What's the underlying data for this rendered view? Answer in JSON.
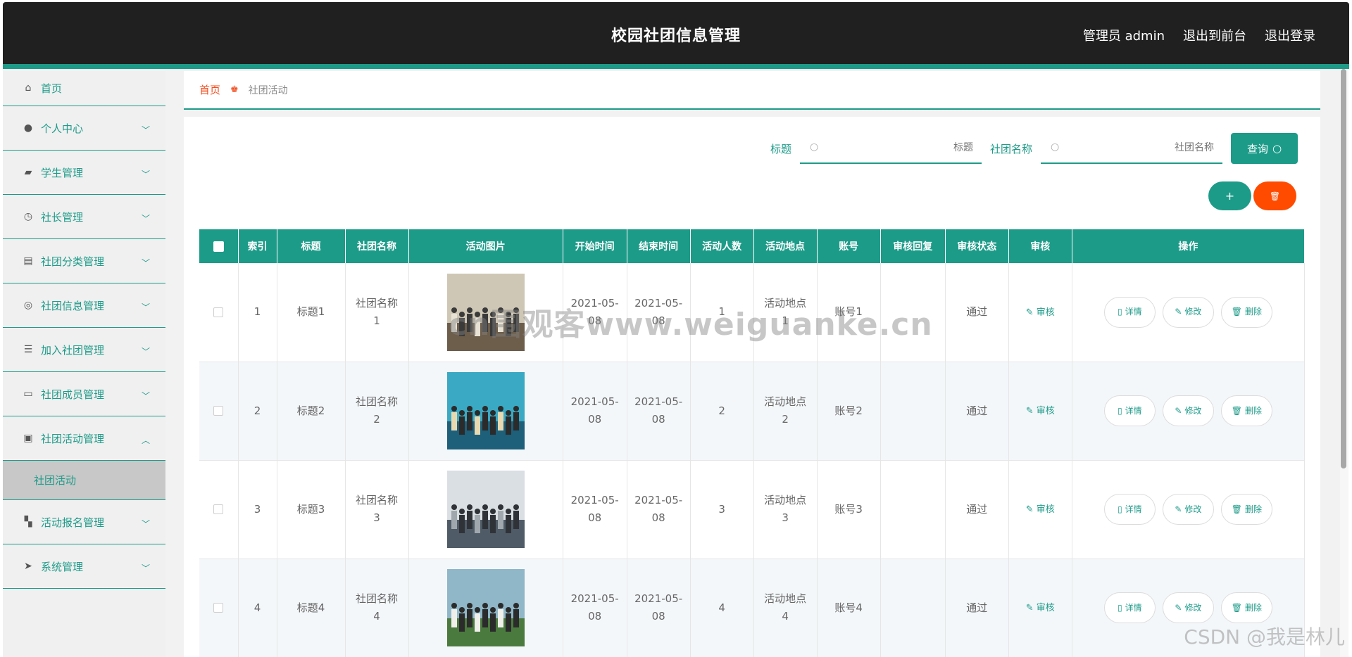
{
  "header": {
    "title": "校园社团信息管理",
    "user": "管理员 admin",
    "front": "退出到前台",
    "logout": "退出登录"
  },
  "sidebar": {
    "items": [
      {
        "label": "首页",
        "icon": "home-icon",
        "glyph": "⌂"
      },
      {
        "label": "个人中心",
        "icon": "user-icon",
        "glyph": "●"
      },
      {
        "label": "学生管理",
        "icon": "wallet-icon",
        "glyph": "▰"
      },
      {
        "label": "社长管理",
        "icon": "clock-icon",
        "glyph": "◷"
      },
      {
        "label": "社团分类管理",
        "icon": "clipboard-icon",
        "glyph": "▤"
      },
      {
        "label": "社团信息管理",
        "icon": "target-icon",
        "glyph": "◎"
      },
      {
        "label": "加入社团管理",
        "icon": "list-icon",
        "glyph": "☰"
      },
      {
        "label": "社团成员管理",
        "icon": "card-icon",
        "glyph": "▭"
      },
      {
        "label": "社团活动管理",
        "icon": "checklist-icon",
        "glyph": "▣"
      },
      {
        "label": "活动报名管理",
        "icon": "ticket-icon",
        "glyph": "▚"
      },
      {
        "label": "系统管理",
        "icon": "send-icon",
        "glyph": "➤"
      }
    ],
    "active_sub": "社团活动"
  },
  "breadcrumb": {
    "home": "首页",
    "current": "社团活动"
  },
  "search": {
    "label1": "标题",
    "placeholder1": "标题",
    "label2": "社团名称",
    "placeholder2": "社团名称",
    "button": "查询"
  },
  "actions": {
    "add": "+",
    "delete": "🗑"
  },
  "table": {
    "headers": [
      "索引",
      "标题",
      "社团名称",
      "活动图片",
      "开始时间",
      "结束时间",
      "活动人数",
      "活动地点",
      "账号",
      "审核回复",
      "审核状态",
      "审核",
      "操作"
    ],
    "audit_label": "审核",
    "op_detail": "详情",
    "op_edit": "修改",
    "op_delete": "删除",
    "rows": [
      {
        "index": "1",
        "title": "标题1",
        "club": "社团名称1",
        "start": "2021-05-08",
        "end": "2021-05-08",
        "count": "1",
        "place": "活动地点1",
        "account": "账号1",
        "reply": "",
        "status": "通过"
      },
      {
        "index": "2",
        "title": "标题2",
        "club": "社团名称2",
        "start": "2021-05-08",
        "end": "2021-05-08",
        "count": "2",
        "place": "活动地点2",
        "account": "账号2",
        "reply": "",
        "status": "通过"
      },
      {
        "index": "3",
        "title": "标题3",
        "club": "社团名称3",
        "start": "2021-05-08",
        "end": "2021-05-08",
        "count": "3",
        "place": "活动地点3",
        "account": "账号3",
        "reply": "",
        "status": "通过"
      },
      {
        "index": "4",
        "title": "标题4",
        "club": "社团名称4",
        "start": "2021-05-08",
        "end": "2021-05-08",
        "count": "4",
        "place": "活动地点4",
        "account": "账号4",
        "reply": "",
        "status": "通过"
      }
    ]
  },
  "watermark": "cn围观客www.weiguanke.cn",
  "csdn": "CSDN @我是林儿",
  "colors": {
    "accent": "#1d9b89",
    "danger": "#ff4b00",
    "header_bg": "#202020",
    "breadcrumb_home": "#f04c1e"
  }
}
